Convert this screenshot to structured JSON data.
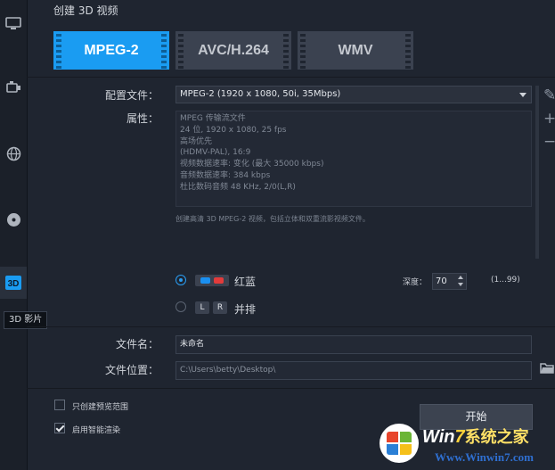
{
  "title": "创建 3D 视频",
  "sidebar": {
    "items": [
      {
        "icon": "monitor-icon"
      },
      {
        "icon": "device-icon"
      },
      {
        "icon": "globe-icon"
      },
      {
        "icon": "disc-icon"
      },
      {
        "icon": "3d-icon",
        "text": "3D"
      }
    ],
    "tooltip": "3D 影片"
  },
  "formats": [
    "MPEG-2",
    "AVC/H.264",
    "WMV"
  ],
  "profile": {
    "label": "配置文件：",
    "value": "MPEG-2 (1920 x 1080, 50i, 35Mbps)"
  },
  "properties": {
    "label": "属性：",
    "lines": [
      "MPEG 传输流文件",
      "24 位, 1920 x 1080, 25 fps",
      "高场优先",
      "(HDMV-PAL), 16:9",
      "视频数据速率: 变化 (最大 35000 kbps)",
      "音频数据速率: 384 kbps",
      "杜比数码音频 48 KHz, 2/0(L,R)"
    ],
    "description": "创建高清 3D MPEG-2 视频，包括立体和双重流影视频文件。"
  },
  "side_buttons": [
    "✎",
    "+",
    "−"
  ],
  "stereo": {
    "anaglyph_label": "红蓝",
    "side_by_side_label": "并排",
    "left": "L",
    "right": "R",
    "selected": "anaglyph",
    "depth_label": "深度：",
    "depth_value": "70",
    "depth_range": "(1...99)"
  },
  "output": {
    "filename_label": "文件名：",
    "filename_value": "未命名",
    "location_label": "文件位置：",
    "location_value": "C:\\Users\\betty\\Desktop\\"
  },
  "options": [
    {
      "label": "只创建预览范围",
      "checked": false
    },
    {
      "label": "启用智能渲染",
      "checked": true
    }
  ],
  "start_label": "开始",
  "watermark": {
    "brand_a": "Win",
    "brand_b": "7",
    "brand_c": "系统之家",
    "url": "Www.Winwin7.com"
  },
  "colors": {
    "accent": "#1a9cf2",
    "background": "#1f2530",
    "anaglyph_blue": "#1a8ff0",
    "anaglyph_red": "#e23b3b"
  }
}
